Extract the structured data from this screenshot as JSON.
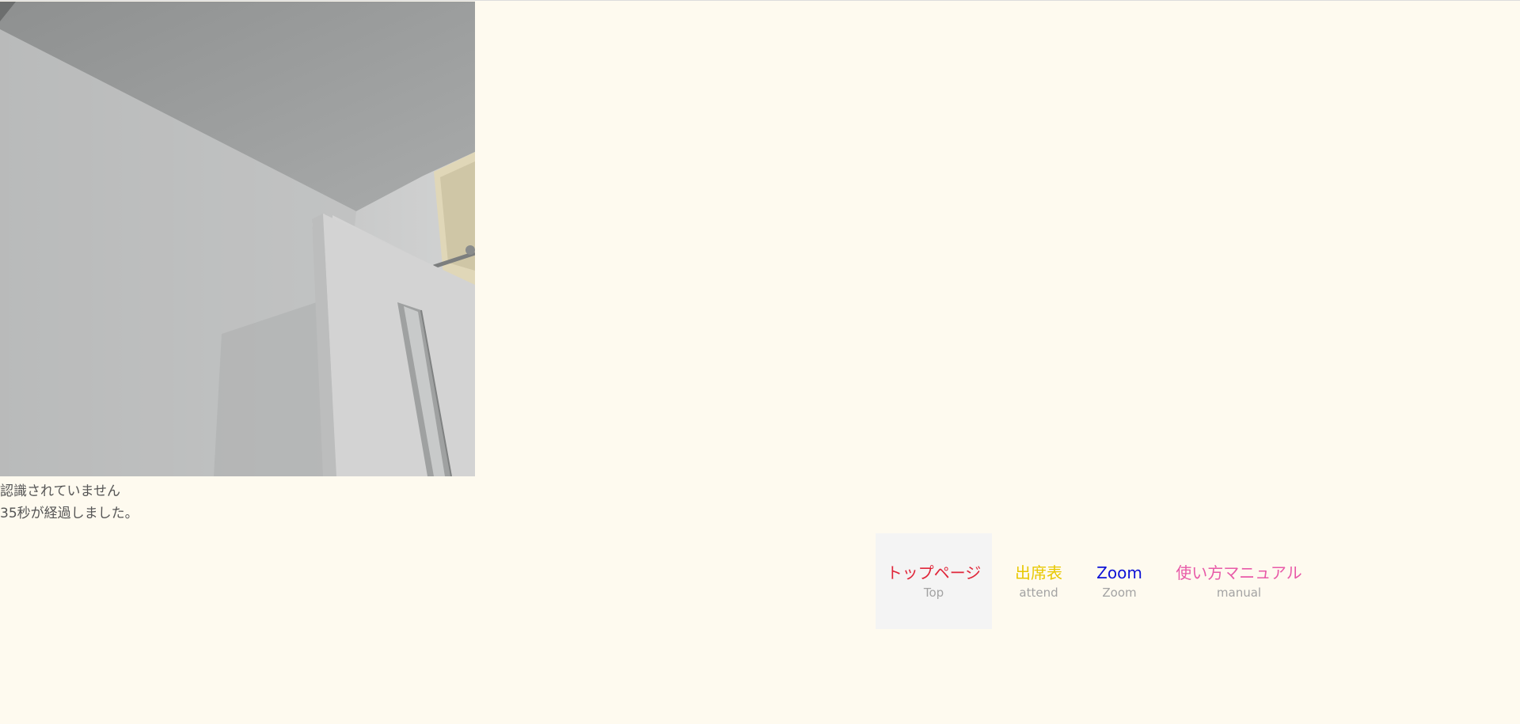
{
  "status": {
    "recognition": "認識されていません",
    "elapsed": "35秒が経過しました。"
  },
  "nav": {
    "items": [
      {
        "label": "トップページ",
        "sub": "Top",
        "color": "#e0263a",
        "active": true
      },
      {
        "label": "出席表",
        "sub": "attend",
        "color": "#e8c800",
        "active": false
      },
      {
        "label": "Zoom",
        "sub": "Zoom",
        "color": "#0d12d6",
        "active": false
      },
      {
        "label": "使い方マニュアル",
        "sub": "manual",
        "color": "#e85aa8",
        "active": false
      }
    ]
  },
  "colors": {
    "background": "#fefaef",
    "status_text": "#555555",
    "sub_text": "#a3a3a3"
  }
}
